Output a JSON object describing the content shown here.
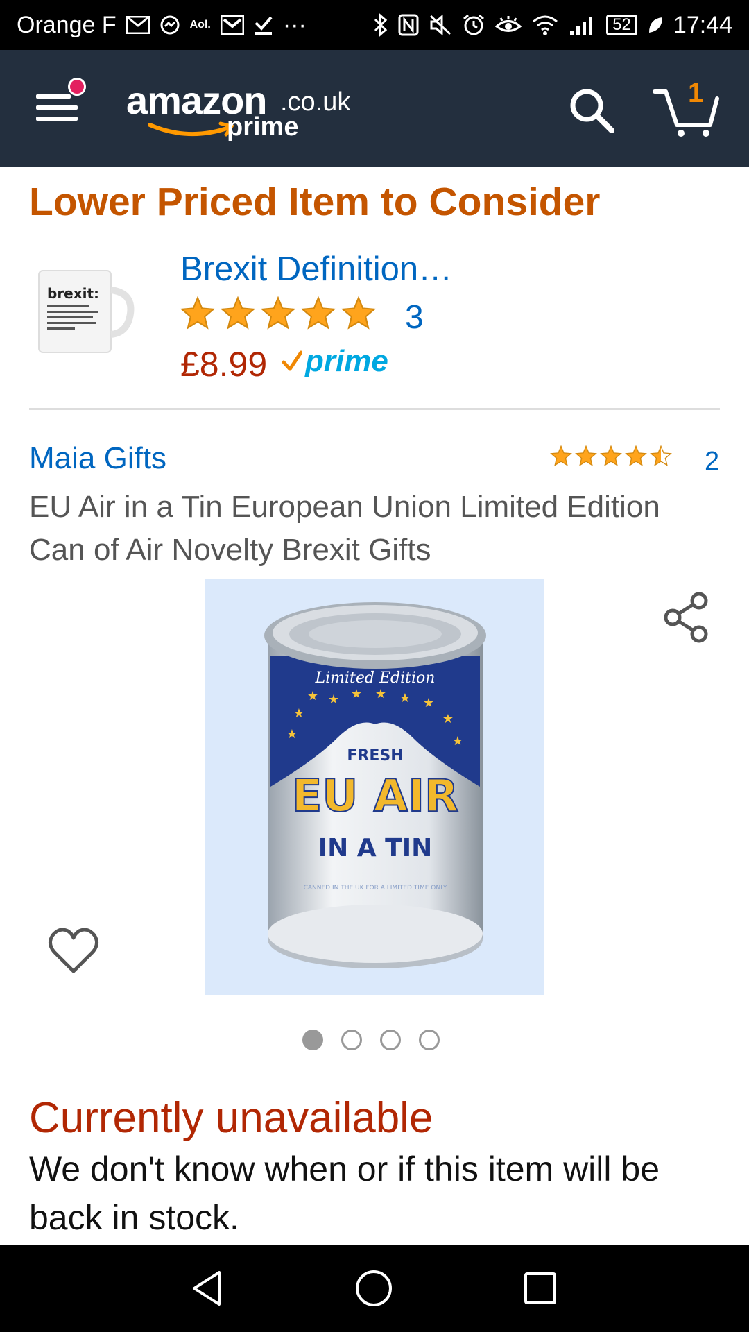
{
  "status_bar": {
    "carrier": "Orange F",
    "aol": "Aol.",
    "battery": "52",
    "time": "17:44"
  },
  "header": {
    "logo_word": "amazon",
    "logo_tld": ".co.uk",
    "logo_prime": "prime",
    "cart_count": "1"
  },
  "recommendation": {
    "section_title": "Lower Priced Item to Consider",
    "title": "Brexit Definition…",
    "rating_stars": 5,
    "review_count": "3",
    "price": "£8.99",
    "prime_label": "prime",
    "thumb_label": "brexit:"
  },
  "product": {
    "brand": "Maia Gifts",
    "rating_stars": 4.5,
    "review_count": "2",
    "title": "EU Air in a Tin European Union Limited Edition Can of Air Novelty Brexit Gifts",
    "image_text": {
      "limited": "Limited Edition",
      "fresh": "FRESH",
      "eu_air": "EU AIR",
      "in_a_tin": "IN A TIN",
      "canned": "CANNED IN THE UK FOR A LIMITED TIME ONLY"
    },
    "carousel_count": 4,
    "carousel_active": 1
  },
  "availability": {
    "title": "Currently unavailable",
    "message": "We don't know when or if this item will be back in stock."
  },
  "colors": {
    "header_bg": "#232f3e",
    "orange": "#c45500",
    "link": "#0066c0",
    "price": "#b12704",
    "prime": "#00a8e1",
    "star": "#ffa41c"
  }
}
